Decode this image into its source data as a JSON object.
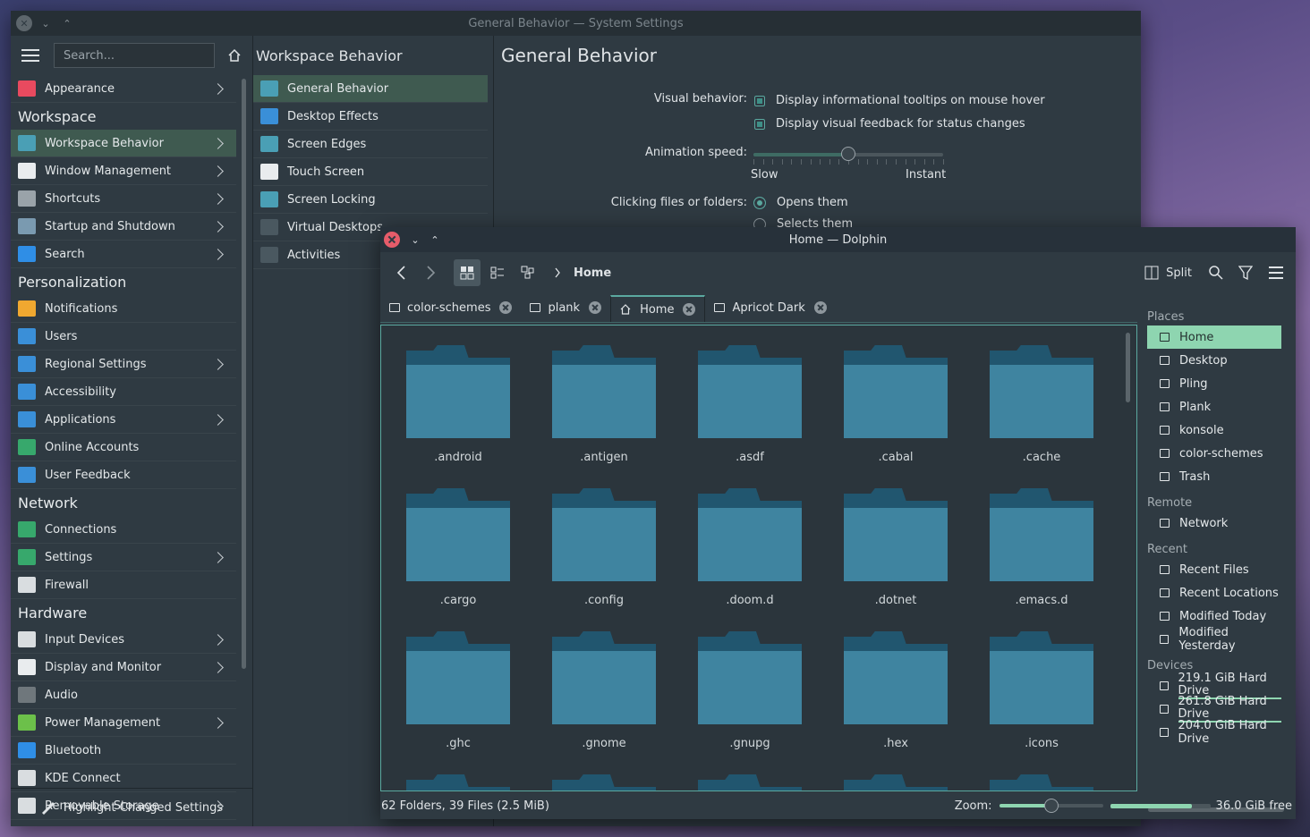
{
  "settings": {
    "window_title": "General Behavior — System Settings",
    "search_placeholder": "Search...",
    "sidebar": [
      {
        "label": "Appearance",
        "chev": true,
        "color": "#e84a5f",
        "type": "item"
      },
      {
        "label": "Workspace",
        "type": "cat"
      },
      {
        "label": "Workspace Behavior",
        "chev": true,
        "color": "#4a9fb5",
        "type": "item",
        "active": true
      },
      {
        "label": "Window Management",
        "chev": true,
        "color": "#e9ecee",
        "type": "item"
      },
      {
        "label": "Shortcuts",
        "chev": true,
        "color": "#9aa3a9",
        "type": "item"
      },
      {
        "label": "Startup and Shutdown",
        "chev": true,
        "color": "#7a9ab0",
        "type": "item"
      },
      {
        "label": "Search",
        "chev": true,
        "color": "#2f8ee6",
        "type": "item"
      },
      {
        "label": "Personalization",
        "type": "cat"
      },
      {
        "label": "Notifications",
        "chev": false,
        "color": "#f0a830",
        "type": "item"
      },
      {
        "label": "Users",
        "chev": false,
        "color": "#3a8fd8",
        "type": "item"
      },
      {
        "label": "Regional Settings",
        "chev": true,
        "color": "#3a8fd8",
        "type": "item"
      },
      {
        "label": "Accessibility",
        "chev": false,
        "color": "#3a8fd8",
        "type": "item"
      },
      {
        "label": "Applications",
        "chev": true,
        "color": "#3a8fd8",
        "type": "item"
      },
      {
        "label": "Online Accounts",
        "chev": false,
        "color": "#37a86c",
        "type": "item"
      },
      {
        "label": "User Feedback",
        "chev": false,
        "color": "#3a8fd8",
        "type": "item"
      },
      {
        "label": "Network",
        "type": "cat"
      },
      {
        "label": "Connections",
        "chev": false,
        "color": "#37a86c",
        "type": "item"
      },
      {
        "label": "Settings",
        "chev": true,
        "color": "#37a86c",
        "type": "item"
      },
      {
        "label": "Firewall",
        "chev": false,
        "color": "#d9dde0",
        "type": "item"
      },
      {
        "label": "Hardware",
        "type": "cat"
      },
      {
        "label": "Input Devices",
        "chev": true,
        "color": "#d9dde0",
        "type": "item"
      },
      {
        "label": "Display and Monitor",
        "chev": true,
        "color": "#e9ecee",
        "type": "item"
      },
      {
        "label": "Audio",
        "chev": false,
        "color": "#6f777c",
        "type": "item"
      },
      {
        "label": "Power Management",
        "chev": true,
        "color": "#6cc04a",
        "type": "item"
      },
      {
        "label": "Bluetooth",
        "chev": false,
        "color": "#2f8ee6",
        "type": "item"
      },
      {
        "label": "KDE Connect",
        "chev": false,
        "color": "#d9dde0",
        "type": "item"
      },
      {
        "label": "Removable Storage",
        "chev": true,
        "color": "#d9dde0",
        "type": "item"
      }
    ],
    "footer_label": "Highlight Changed Settings",
    "middle": {
      "title": "Workspace Behavior",
      "items": [
        {
          "label": "General Behavior",
          "active": true,
          "color": "#4a9fb5"
        },
        {
          "label": "Desktop Effects",
          "color": "#3a8fd8"
        },
        {
          "label": "Screen Edges",
          "color": "#4a9fb5"
        },
        {
          "label": "Touch Screen",
          "color": "#e9ecee"
        },
        {
          "label": "Screen Locking",
          "color": "#4a9fb5"
        },
        {
          "label": "Virtual Desktops",
          "color": "#4a5860"
        },
        {
          "label": "Activities",
          "color": "#4a5860"
        }
      ]
    },
    "right": {
      "title": "General Behavior",
      "visual_label": "Visual behavior:",
      "check1": "Display informational tooltips on mouse hover",
      "check2": "Display visual feedback for status changes",
      "anim_label": "Animation speed:",
      "anim_value": 0.5,
      "slow": "Slow",
      "instant": "Instant",
      "click_label": "Clicking files or folders:",
      "radio1": "Opens them",
      "radio2": "Selects them"
    }
  },
  "dolphin": {
    "window_title": "Home — Dolphin",
    "breadcrumb": "Home",
    "split_label": "Split",
    "tabs": [
      {
        "label": "color-schemes"
      },
      {
        "label": "plank"
      },
      {
        "label": "Home",
        "active": true
      },
      {
        "label": "Apricot Dark"
      }
    ],
    "folders": [
      ".android",
      ".antigen",
      ".asdf",
      ".cabal",
      ".cache",
      ".cargo",
      ".config",
      ".doom.d",
      ".dotnet",
      ".emacs.d",
      ".ghc",
      ".gnome",
      ".gnupg",
      ".hex",
      ".icons",
      "",
      "",
      "",
      "",
      ""
    ],
    "places": {
      "places_head": "Places",
      "places": [
        "Home",
        "Desktop",
        "Pling",
        "Plank",
        "konsole",
        "color-schemes",
        "Trash"
      ],
      "remote_head": "Remote",
      "remote": [
        "Network"
      ],
      "recent_head": "Recent",
      "recent": [
        "Recent Files",
        "Recent Locations",
        "Modified Today",
        "Modified Yesterday"
      ],
      "devices_head": "Devices",
      "devices": [
        "219.1 GiB Hard Drive",
        "261.8 GiB Hard Drive",
        "204.0 GiB Hard Drive"
      ]
    },
    "status_text": "62 Folders, 39 Files (2.5 MiB)",
    "zoom_label": "Zoom:",
    "zoom_value": 0.5,
    "free_label": "36.0 GiB free",
    "disk_used": 0.82
  }
}
